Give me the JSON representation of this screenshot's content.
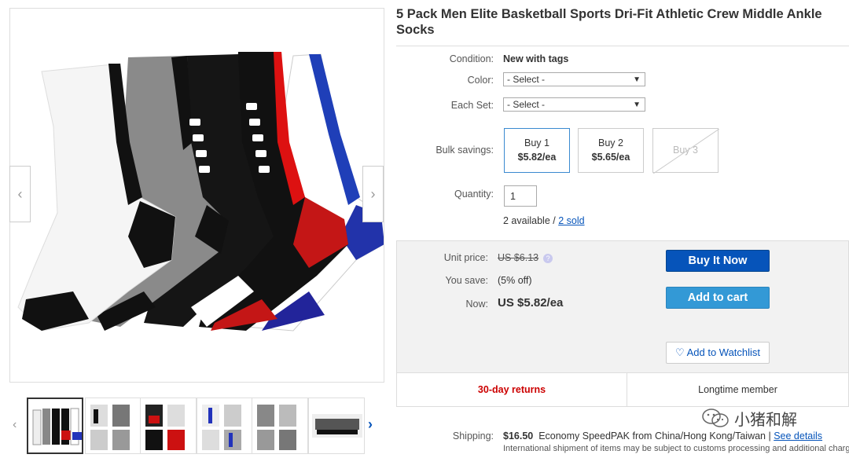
{
  "product": {
    "title": "5 Pack Men Elite Basketball Sports Dri-Fit Athletic Crew Middle Ankle Socks"
  },
  "gallery": {
    "prev_arrow": "‹",
    "next_arrow": "›",
    "thumb_prev": "‹",
    "thumb_next": "›",
    "thumb_count": 6,
    "active_thumb": 1
  },
  "details": {
    "condition_label": "Condition:",
    "condition_value": "New with tags",
    "color_label": "Color:",
    "color_value": "- Select -",
    "each_set_label": "Each Set:",
    "each_set_value": "- Select -",
    "bulk_label": "Bulk savings:",
    "bulk_options": [
      {
        "qty": "Buy 1",
        "price": "$5.82/ea",
        "selected": true,
        "disabled": false
      },
      {
        "qty": "Buy 2",
        "price": "$5.65/ea",
        "selected": false,
        "disabled": false
      },
      {
        "qty": "Buy 3",
        "price": "",
        "selected": false,
        "disabled": true
      }
    ],
    "quantity_label": "Quantity:",
    "quantity_value": "1",
    "available_text": "2 available / ",
    "sold_link": "2 sold"
  },
  "buybox": {
    "unit_price_label": "Unit price:",
    "unit_price_value": "US $6.13",
    "you_save_label": "You save:",
    "you_save_value": "(5% off)",
    "now_label": "Now:",
    "now_value": "US $5.82/ea",
    "buy_now": "Buy It Now",
    "add_to_cart": "Add to cart",
    "watchlist": "Add to Watchlist",
    "returns": "30-day returns",
    "member": "Longtime member"
  },
  "shipping": {
    "label": "Shipping:",
    "price": "$16.50",
    "method": "Economy SpeedPAK from China/Hong Kong/Taiwan | ",
    "see_details": "See details",
    "note": "International shipment of items may be subject to customs processing and additional charges."
  },
  "watermark": {
    "text": "小猪和解"
  },
  "colors": {
    "link": "#0654ba",
    "buy_now": "#0654ba",
    "add_to_cart": "#3399d6",
    "returns": "#cc0000"
  }
}
